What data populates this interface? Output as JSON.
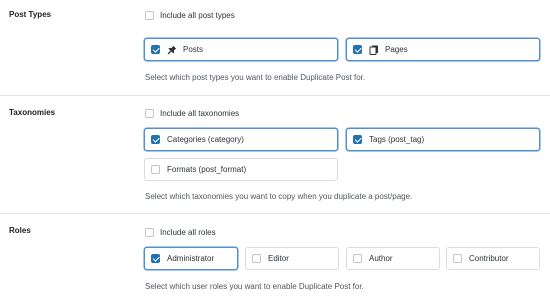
{
  "post_types": {
    "label": "Post Types",
    "include_all_label": "Include all post types",
    "include_all_checked": false,
    "options": [
      {
        "label": "Posts",
        "checked": true,
        "icon": "pin-icon"
      },
      {
        "label": "Pages",
        "checked": true,
        "icon": "pages-icon"
      }
    ],
    "description": "Select which post types you want to enable Duplicate Post for."
  },
  "taxonomies": {
    "label": "Taxonomies",
    "include_all_label": "Include all taxonomies",
    "include_all_checked": false,
    "options": [
      {
        "label": "Categories (category)",
        "checked": true
      },
      {
        "label": "Tags (post_tag)",
        "checked": true
      },
      {
        "label": "Formats (post_format)",
        "checked": false
      }
    ],
    "description": "Select which taxonomies you want to copy when you duplicate a post/page."
  },
  "roles": {
    "label": "Roles",
    "include_all_label": "Include all roles",
    "include_all_checked": false,
    "options": [
      {
        "label": "Administrator",
        "checked": true
      },
      {
        "label": "Editor",
        "checked": false
      },
      {
        "label": "Author",
        "checked": false
      },
      {
        "label": "Contributor",
        "checked": false
      }
    ],
    "description": "Select which user roles you want to enable Duplicate Post for."
  },
  "colors": {
    "accent": "#2271b1",
    "selected_border": "#4f8fd4",
    "border": "#dcdcde",
    "text": "#2c3338",
    "muted": "#50575e"
  }
}
